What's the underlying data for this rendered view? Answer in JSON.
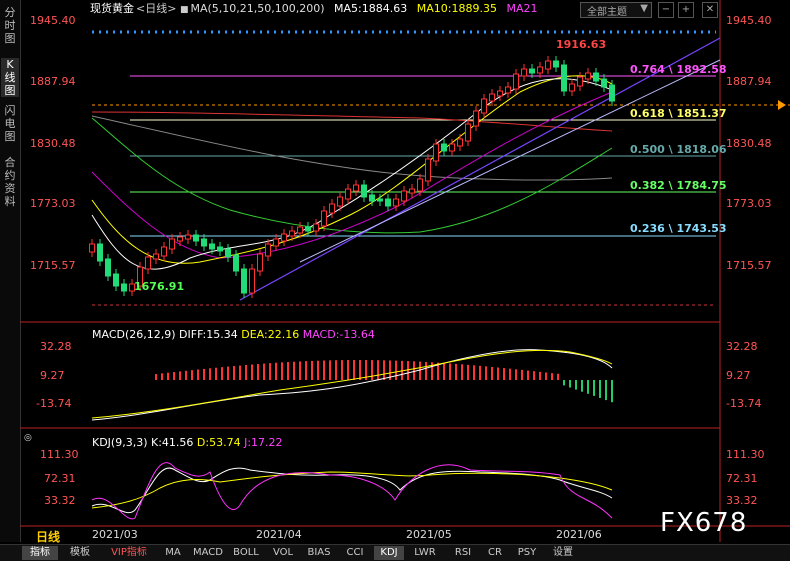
{
  "sidebar": {
    "tabs": [
      {
        "label": "分时图"
      },
      {
        "label": "K线图"
      },
      {
        "label": "闪电图"
      },
      {
        "label": "合约资料"
      }
    ]
  },
  "header": {
    "instrument": "现货黄金",
    "period_tag": "<日线>",
    "ma_label": "MA(5,10,21,50,100,200)",
    "ma5": "MA5:1884.63",
    "ma10": "MA10:1889.35",
    "ma21": "MA21",
    "theme_selector": "全部主题",
    "colors": {
      "ma5": "#ffffff",
      "ma10": "#ffff00",
      "ma21": "#ff00ff"
    }
  },
  "price_axis": {
    "labels": [
      "1945.40",
      "1887.94",
      "1830.48",
      "1773.03",
      "1715.57"
    ]
  },
  "fib_levels": [
    {
      "label": "0.764 \\ 1892.58",
      "color": "#ff55ff"
    },
    {
      "label": "0.618 \\ 1851.37",
      "color": "#ffff66"
    },
    {
      "label": "0.500 \\ 1818.06",
      "color": "#66aaaa"
    },
    {
      "label": "0.382 \\ 1784.75",
      "color": "#66ff66"
    },
    {
      "label": "0.236 \\ 1743.53",
      "color": "#88ddff"
    }
  ],
  "annotations": {
    "high": "1916.63",
    "low": "1676.91"
  },
  "macd": {
    "label": "MACD(26,12,9)",
    "diff": "DIFF:15.34",
    "dea": "DEA:22.16",
    "macd": "MACD:-13.64",
    "axis": [
      "32.28",
      "9.27",
      "-13.74"
    ]
  },
  "kdj": {
    "label": "KDJ(9,3,3)",
    "k": "K:41.56",
    "d": "D:53.74",
    "j": "J:17.22",
    "axis": [
      "111.30",
      "72.31",
      "33.32"
    ]
  },
  "dates": [
    "2021/03",
    "2021/04",
    "2021/05",
    "2021/06"
  ],
  "period_button": "日线",
  "bottom_tabs": [
    "指标",
    "模板",
    "VIP指标",
    "MA",
    "MACD",
    "BOLL",
    "VOL",
    "BIAS",
    "CCI",
    "KDJ",
    "LWR",
    "RSI",
    "CR",
    "PSY",
    "设置"
  ],
  "watermark": "FX678"
}
